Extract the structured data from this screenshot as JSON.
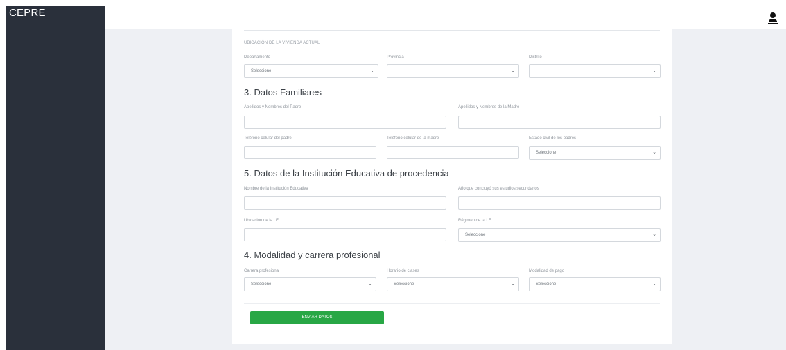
{
  "sidebar": {
    "brand": "CEPRE",
    "menu_icon": "hamburger-icon"
  },
  "topbar": {
    "user_icon": "user-icon"
  },
  "ubicacion": {
    "caption": "UBICACIÓN DE LA VIVIENDA ACTUAL",
    "departamento": {
      "label": "Departamento",
      "value": "Seleccione"
    },
    "provincia": {
      "label": "Provincia",
      "value": ""
    },
    "distrito": {
      "label": "Distrito",
      "value": ""
    }
  },
  "familiares": {
    "title": "3. Datos Familiares",
    "padre_nombre": {
      "label": "Apellidos y Nombres del Padre",
      "value": ""
    },
    "madre_nombre": {
      "label": "Apellidos y Nombres de la Madre",
      "value": ""
    },
    "padre_tel": {
      "label": "Teléfono celular del padre",
      "value": ""
    },
    "madre_tel": {
      "label": "Teléfono celular de la madre",
      "value": ""
    },
    "estado_civil": {
      "label": "Estado civil de los padres",
      "value": "Seleccione"
    }
  },
  "institucion": {
    "title": "5. Datos de la Institución Educativa de procedencia",
    "nombre": {
      "label": "Nombre de la Institución Educativa",
      "value": ""
    },
    "anio": {
      "label": "Año que concluyó sus estudios secundarios",
      "value": ""
    },
    "ubicacion": {
      "label": "Ubicación de la I.E.",
      "value": ""
    },
    "regimen": {
      "label": "Régimen de la I.E.",
      "value": "Seleccione"
    }
  },
  "modalidad": {
    "title": "4. Modalidad y carrera profesional",
    "carrera": {
      "label": "Carrera profesional",
      "value": "Seleccione"
    },
    "horario": {
      "label": "Horario de clases",
      "value": "Seleccione"
    },
    "pago": {
      "label": "Modalidad de pago",
      "value": "Seleccione"
    }
  },
  "submit_label": "ENVIAR DATOS",
  "colors": {
    "sidebar": "#2a303b",
    "content_bg": "#eef0f4",
    "button": "#28a745"
  }
}
